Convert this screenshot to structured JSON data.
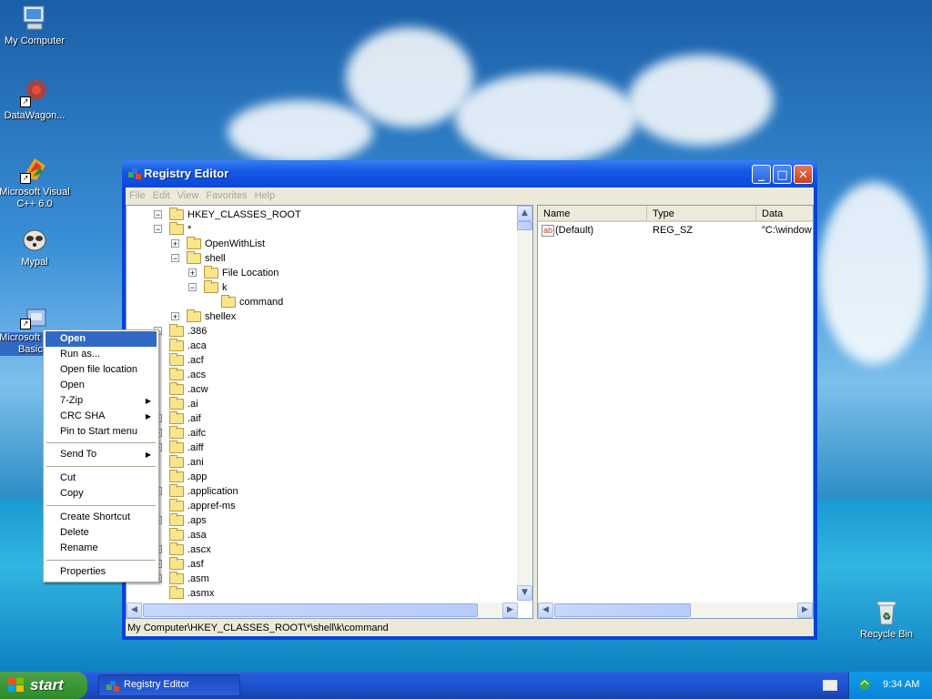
{
  "desktop": {
    "icons": [
      {
        "label": "My Computer",
        "icon": "computer-icon"
      },
      {
        "label": "DataWagon...",
        "icon": "datawagon-icon"
      },
      {
        "label": "Microsoft Visual C++ 6.0",
        "icon": "visual-cpp-icon"
      },
      {
        "label": "Mypal",
        "icon": "mypal-icon"
      },
      {
        "label": "Microsoft Visual Basic 6",
        "icon": "visual-basic-icon"
      },
      {
        "label": "Recycle Bin",
        "icon": "recycle-bin-icon"
      }
    ]
  },
  "window": {
    "title": "Registry Editor",
    "controls": {
      "minimize": "_",
      "maximize": "□",
      "close": "✕"
    },
    "menu": [
      "File",
      "Edit",
      "View",
      "Favorites",
      "Help"
    ],
    "tree": [
      {
        "label": "HKEY_CLASSES_ROOT",
        "expander": "−"
      },
      {
        "label": "*",
        "expander": "−"
      },
      {
        "label": "OpenWithList",
        "expander": "+"
      },
      {
        "label": "shell",
        "expander": "−"
      },
      {
        "label": "File Location",
        "expander": "+"
      },
      {
        "label": "k",
        "expander": "−"
      },
      {
        "label": "command",
        "expander": ""
      },
      {
        "label": "shellex",
        "expander": "+"
      },
      {
        "label": ".386",
        "expander": "+"
      },
      {
        "label": ".aca",
        "expander": ""
      },
      {
        "label": ".acf",
        "expander": ""
      },
      {
        "label": ".acs",
        "expander": ""
      },
      {
        "label": ".acw",
        "expander": ""
      },
      {
        "label": ".ai",
        "expander": ""
      },
      {
        "label": ".aif",
        "expander": "+"
      },
      {
        "label": ".aifc",
        "expander": "+"
      },
      {
        "label": ".aiff",
        "expander": "+"
      },
      {
        "label": ".ani",
        "expander": ""
      },
      {
        "label": ".app",
        "expander": ""
      },
      {
        "label": ".application",
        "expander": "+"
      },
      {
        "label": ".appref-ms",
        "expander": ""
      },
      {
        "label": ".aps",
        "expander": "+"
      },
      {
        "label": ".asa",
        "expander": ""
      },
      {
        "label": ".ascx",
        "expander": "+"
      },
      {
        "label": ".asf",
        "expander": "+"
      },
      {
        "label": ".asm",
        "expander": "+"
      },
      {
        "label": ".asmx",
        "expander": ""
      }
    ],
    "list": {
      "columns": [
        "Name",
        "Type",
        "Data"
      ],
      "rows": [
        {
          "name": "(Default)",
          "type": "REG_SZ",
          "data": "\"C:\\window"
        }
      ],
      "value_icon": "ab"
    },
    "status": "My Computer\\HKEY_CLASSES_ROOT\\*\\shell\\k\\command"
  },
  "context_menu": {
    "items": [
      {
        "label": "Open",
        "selected": true,
        "submenu": false
      },
      {
        "label": "Run as...",
        "submenu": false
      },
      {
        "label": "Open file location",
        "submenu": false
      },
      {
        "label": "Open",
        "submenu": false
      },
      {
        "label": "7-Zip",
        "submenu": true
      },
      {
        "label": "CRC SHA",
        "submenu": true
      },
      {
        "label": "Pin to Start menu",
        "submenu": false
      },
      {
        "label": "Send To",
        "submenu": true
      },
      {
        "label": "Cut",
        "submenu": false
      },
      {
        "label": "Copy",
        "submenu": false
      },
      {
        "label": "Create Shortcut",
        "submenu": false
      },
      {
        "label": "Delete",
        "submenu": false
      },
      {
        "label": "Rename",
        "submenu": false
      },
      {
        "label": "Properties",
        "submenu": false
      }
    ],
    "submenu_arrow": "▶"
  },
  "taskbar": {
    "start_label": "start",
    "task_button": "Registry Editor",
    "clock": "9:34 AM"
  },
  "colors": {
    "selection": "#316ac5",
    "titlebar": "#0a48d6",
    "taskbar": "#245edb",
    "start_button": "#3c9a3a"
  }
}
